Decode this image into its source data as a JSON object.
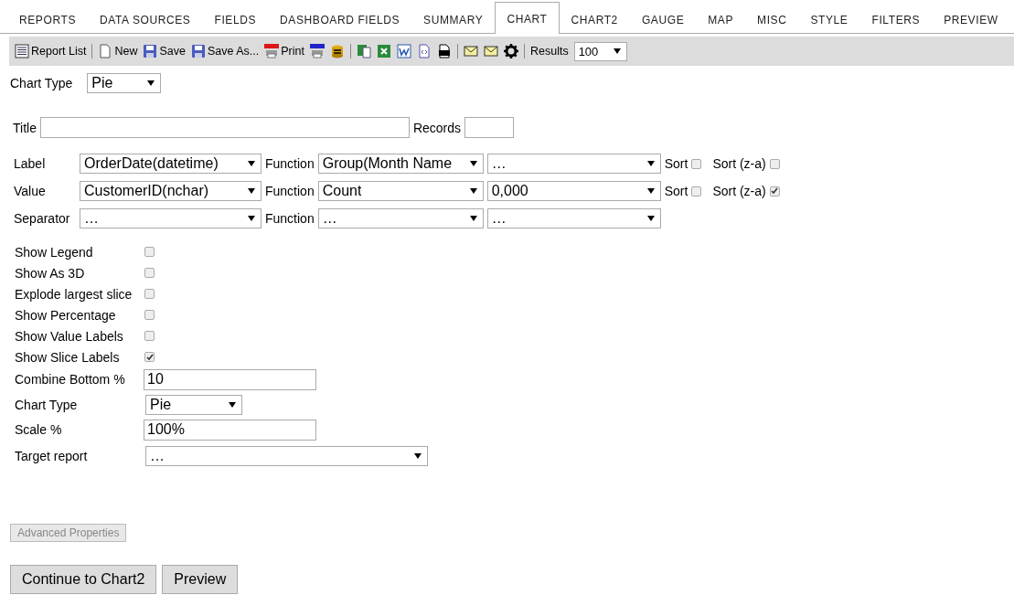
{
  "tabs": [
    {
      "label": "REPORTS",
      "selected": false
    },
    {
      "label": "DATA SOURCES",
      "selected": false
    },
    {
      "label": "FIELDS",
      "selected": false
    },
    {
      "label": "DASHBOARD FIELDS",
      "selected": false
    },
    {
      "label": "SUMMARY",
      "selected": false
    },
    {
      "label": "CHART",
      "selected": true
    },
    {
      "label": "CHART2",
      "selected": false
    },
    {
      "label": "GAUGE",
      "selected": false
    },
    {
      "label": "MAP",
      "selected": false
    },
    {
      "label": "MISC",
      "selected": false
    },
    {
      "label": "STYLE",
      "selected": false
    },
    {
      "label": "FILTERS",
      "selected": false
    },
    {
      "label": "PREVIEW",
      "selected": false
    }
  ],
  "toolbar": {
    "items": [
      {
        "kind": "labeled",
        "label": "Report List"
      },
      {
        "kind": "separator"
      },
      {
        "kind": "labeled",
        "label": "New"
      },
      {
        "kind": "labeled",
        "label": "Save"
      },
      {
        "kind": "labeled",
        "label": "Save As..."
      },
      {
        "kind": "labeled",
        "label": "Print"
      },
      {
        "kind": "icon"
      },
      {
        "kind": "icon"
      },
      {
        "kind": "separator"
      },
      {
        "kind": "icon"
      },
      {
        "kind": "icon"
      },
      {
        "kind": "icon"
      },
      {
        "kind": "icon"
      },
      {
        "kind": "icon"
      },
      {
        "kind": "separator"
      },
      {
        "kind": "icon"
      },
      {
        "kind": "icon"
      },
      {
        "kind": "icon"
      },
      {
        "kind": "separator"
      }
    ],
    "results_label": "Results",
    "results_value": "100"
  },
  "chart_type": {
    "label": "Chart Type",
    "value": "Pie"
  },
  "title": {
    "label": "Title"
  },
  "records": {
    "label": "Records"
  },
  "series_rows": [
    {
      "label": "Label",
      "field": "OrderDate(datetime)",
      "function_label": "Function",
      "function": "Group(Month Name",
      "format": "…",
      "sort_label": "Sort",
      "sort": false,
      "sort_desc_label": "Sort (z-a)",
      "sort_desc": false
    },
    {
      "label": "Value",
      "field": "CustomerID(nchar)",
      "function_label": "Function",
      "function": "Count",
      "format": "0,000",
      "sort_label": "Sort",
      "sort": false,
      "sort_desc_label": "Sort (z-a)",
      "sort_desc": true
    },
    {
      "label": "Separator",
      "field": "…",
      "function_label": "Function",
      "function": "…",
      "format": "…"
    }
  ],
  "options": [
    {
      "kind": "checkbox",
      "label": "Show Legend",
      "checked": false
    },
    {
      "kind": "checkbox",
      "label": "Show As 3D",
      "checked": false
    },
    {
      "kind": "checkbox",
      "label": "Explode largest slice",
      "checked": false
    },
    {
      "kind": "checkbox",
      "label": "Show Percentage",
      "checked": false
    },
    {
      "kind": "checkbox",
      "label": "Show Value Labels",
      "checked": false
    },
    {
      "kind": "checkbox",
      "label": "Show Slice Labels",
      "checked": true
    },
    {
      "kind": "input",
      "label": "Combine Bottom %",
      "value": "10"
    },
    {
      "kind": "select",
      "label": "Chart Type",
      "value": "Pie"
    },
    {
      "kind": "input",
      "label": "Scale %",
      "value": "100%"
    },
    {
      "kind": "wide_select",
      "label": "Target report",
      "value": "…"
    }
  ],
  "advanced_button": "Advanced Properties",
  "buttons": [
    "Continue to Chart2",
    "Preview"
  ]
}
